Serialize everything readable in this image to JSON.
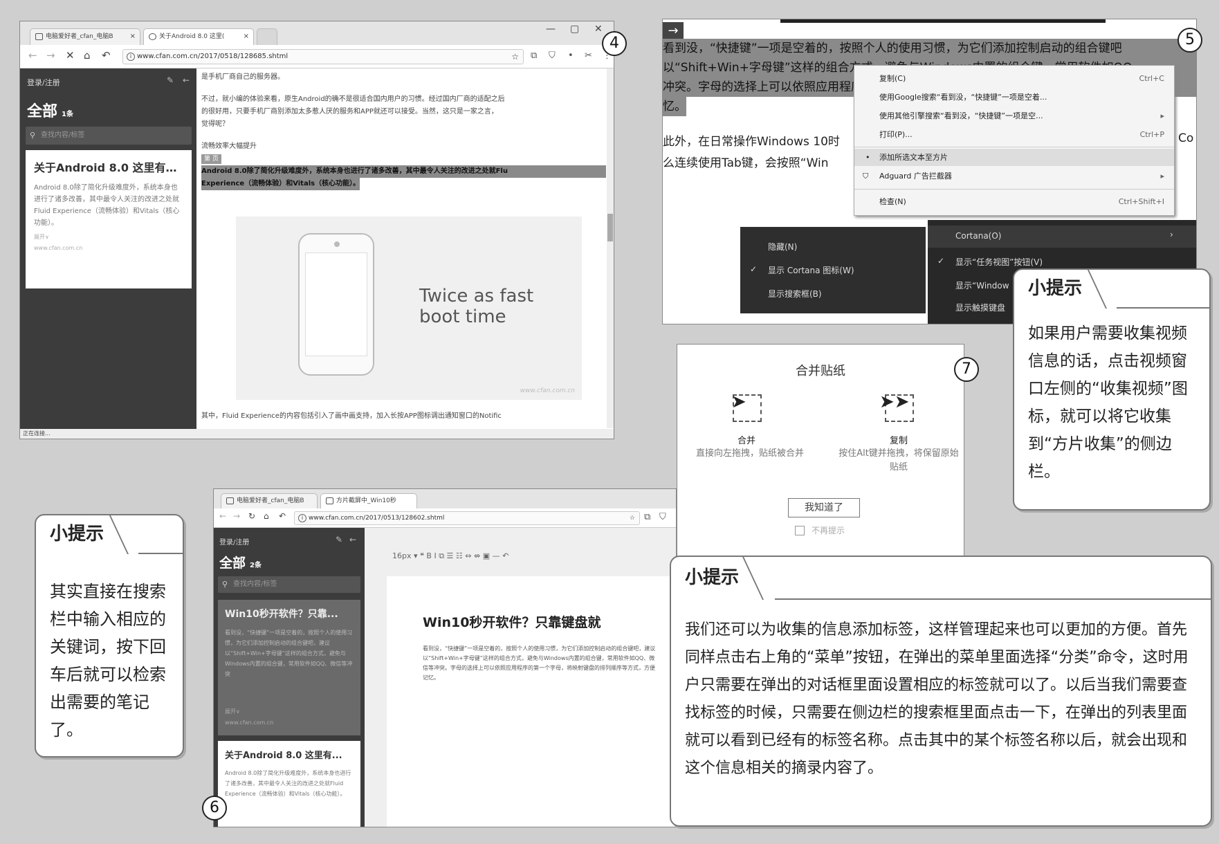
{
  "s4": {
    "number": "4",
    "tabs": [
      "电脑爱好者_cfan_电脑B",
      "关于Android 8.0 这里("
    ],
    "window_controls": [
      "—",
      "▢",
      "✕"
    ],
    "url": "www.cfan.com.cn/2017/0518/128685.shtml",
    "sidebar": {
      "login": "登录/注册",
      "all_label": "全部",
      "all_count": "1条",
      "search_placeholder": "查找内容/标签",
      "card_title": "关于Android 8.0 这里有…",
      "card_body": "Android 8.0除了简化升级难度外，系统本身也进行了诸多改善，其中最令人关注的改进之处就Fluid Experience（流畅体验）和Vitals（核心功能）。",
      "card_more": "展开∨",
      "card_link": "www.cfan.com.cn"
    },
    "content_lines": [
      "是手机厂商自己的服务器。",
      "不过，就小编的体验来看，原生Android的确不是很适合国内用户的习惯。经过国内厂商的适配之后",
      "的很好用，只要手机厂商别添加太多惹人厌的服务和APP就还可以接受。当然，这只是一家之言，",
      "觉得呢？",
      "流畅效率大幅提升"
    ],
    "tag": "第 页",
    "highlight_lines": [
      "Android 8.0除了简化升级难度外，系统本身也进行了诸多改善，其中最令人关注的改进之处就Flu",
      "Experience（流畅体验）和Vitals（核心功能）。"
    ],
    "image_text_1": "Twice as fast",
    "image_text_2": "boot time",
    "image_watermark": "www.cfan.com.cn",
    "bottom_line": "其中，Fluid Experience的内容包括引入了画中画支持，加入长按APP图标调出通知窗口的Notific",
    "status": "正在连接..."
  },
  "s5": {
    "number": "5",
    "text_lines": [
      "看到没，“快捷键”一项是空着的，按照个人的使用习惯，为它们添加控制启动的组合键吧",
      "以“Shift+Win+字母键”这样的组合方式，避免与Windows内置的组合键，常用软件如QQ、",
      "冲突。字母的选择上可以依照应用程序的第一个字母，将映射键盘的排列顺序等方式，",
      "忆。",
      "此外，在日常操作Windows 10时",
      "么连续使用Tab键，会按照“Win"
    ],
    "right_edge": "Co",
    "menu": [
      {
        "label": "复制(C)",
        "shortcut": "Ctrl+C"
      },
      {
        "label": "使用Google搜索“看到没，“快捷键”一项是空着...",
        "shortcut": ""
      },
      {
        "label": "使用其他引擎搜索“看到没，“快捷键”一项是空...",
        "shortcut": "▸"
      },
      {
        "label": "打印(P)...",
        "shortcut": "Ctrl+P"
      },
      {
        "label": "添加所选文本至方片",
        "shortcut": ""
      },
      {
        "label": "Adguard 广告拦截器",
        "shortcut": "▸"
      },
      {
        "label": "检查(N)",
        "shortcut": "Ctrl+Shift+I"
      }
    ],
    "taskbar_left": [
      "隐藏(N)",
      "显示 Cortana 图标(W)",
      "显示搜索框(B)"
    ],
    "taskbar_right": [
      "Cortana(O)",
      "显示“任务视图”按钮(V)",
      "显示“Window",
      "显示触摸键盘"
    ]
  },
  "s7": {
    "number": "7",
    "title": "合并贴纸",
    "merge_label": "合并",
    "merge_desc": "直接向左拖拽，贴纸被合并",
    "copy_label": "复制",
    "copy_desc": "按住Alt键并拖拽，将保留原始贴纸",
    "ok_button": "我知道了",
    "checkbox_label": "不再提示"
  },
  "s6": {
    "number": "6",
    "tabs": [
      "电脑爱好者_cfan_电脑B",
      "方片截屏中_Win10秒"
    ],
    "url": "www.cfan.com.cn/2017/0513/128602.shtml",
    "sidebar": {
      "login": "登录/注册",
      "all_label": "全部",
      "all_count": "2条",
      "search_placeholder": "查找内容/标签",
      "card1_title": "Win10秒开软件？只靠...",
      "card1_body": "看到没，“快捷键”一项是空着的，按照个人的使用习惯，为它们添加控制启动的组合键吧，建议以“Shift+Win+字母键”这样的组合方式，避免与Windows内置的组合键，常用软件如QQ、微信等冲突",
      "card1_more": "展开∨",
      "card1_link": "www.cfan.com.cn",
      "card2_title": "关于Android 8.0 这里有...",
      "card2_body": "Android 8.0除了简化升级难度外，系统本身也进行了诸多改善，其中最令人关注的改进之处就Fluid Experience（流畅体验）和Vitals（核心功能）。"
    },
    "toolbar": "16px ▾   ❝   B   I   ⧉   ☰   ☷   ⇔   ⇎   ▣   —   ↶",
    "article_title": "Win10秒开软件？只靠键盘就",
    "article_body": "看到没，“快捷键”一项是空着的，按照个人的使用习惯，为它们添加控制启动的组合键吧，建议以“Shift+Win+字母键”这样的组合方式，避免与Windows内置的组合键，常用软件如QQ、微信等冲突。字母的选择上可以依照应用程序的第一个字母，将映射键盘的排列顺序等方式，方便记忆。"
  },
  "tips": [
    {
      "head": "小提示",
      "body": "如果用户需要收集视频信息的话，点击视频窗口左侧的“收集视频”图标，就可以将它收集到“方片收集”的侧边栏。"
    },
    {
      "head": "小提示",
      "body": "其实直接在搜索栏中输入相应的关键词，按下回车后就可以检索出需要的笔记了。"
    },
    {
      "head": "小提示",
      "body": "我们还可以为收集的信息添加标签，这样管理起来也可以更加的方便。首先同样点击右上角的“菜单”按钮，在弹出的菜单里面选择“分类”命令，这时用户只需要在弹出的对话框里面设置相应的标签就可以了。以后当我们需要查找标签的时候，只需要在侧边栏的搜索框里面点击一下，在弹出的列表里面就可以看到已经有的标签名称。点击其中的某个标签名称以后，就会出现和这个信息相关的摘录内容了。"
    }
  ]
}
